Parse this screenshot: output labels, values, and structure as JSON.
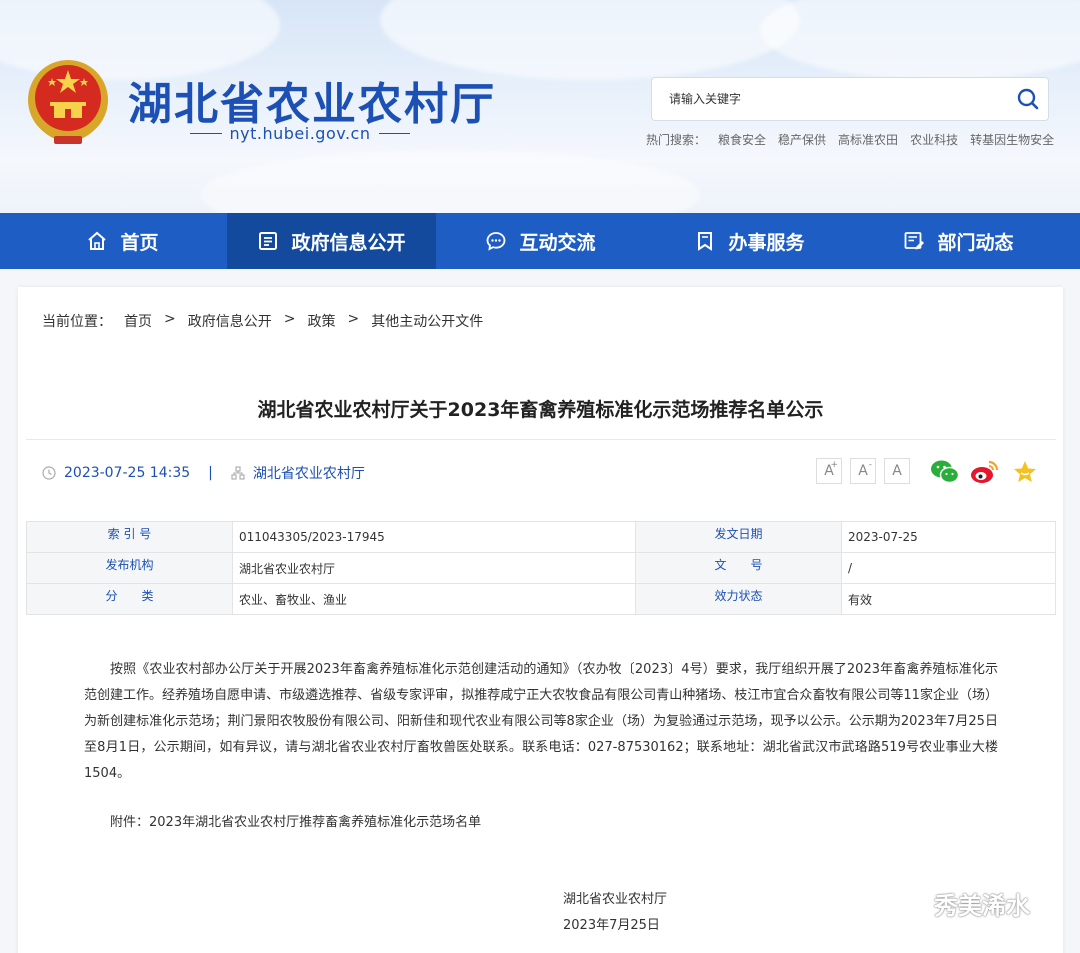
{
  "header": {
    "site_title": "湖北省农业农村厅",
    "site_url": "nyt.hubei.gov.cn",
    "search": {
      "placeholder": "请输入关键字"
    },
    "hot_search": {
      "label": "热门搜索：",
      "items": [
        "粮食安全",
        "稳产保供",
        "高标准农田",
        "农业科技",
        "转基因生物安全"
      ]
    }
  },
  "nav": {
    "items": [
      {
        "label": "首页",
        "icon": "home-icon"
      },
      {
        "label": "政府信息公开",
        "icon": "document-list-icon"
      },
      {
        "label": "互动交流",
        "icon": "chat-icon"
      },
      {
        "label": "办事服务",
        "icon": "bookmark-icon"
      },
      {
        "label": "部门动态",
        "icon": "news-icon"
      }
    ],
    "active_index": 1
  },
  "breadcrumb": {
    "label": "当前位置：",
    "items": [
      "首页",
      "政府信息公开",
      "政策",
      "其他主动公开文件"
    ],
    "separator": ">"
  },
  "article": {
    "title": "湖北省农业农村厅关于2023年畜禽养殖标准化示范场推荐名单公示",
    "datetime": "2023-07-25 14:35",
    "meta_separator": "|",
    "source": "湖北省农业农村厅",
    "font_buttons": [
      "A",
      "A",
      "A"
    ],
    "font_button_sup": [
      "+",
      "-"
    ],
    "info": {
      "rows": [
        {
          "k1": "索 引 号",
          "v1": "011043305/2023-17945",
          "k2": "发文日期",
          "v2": "2023-07-25"
        },
        {
          "k1": "发布机构",
          "v1": "湖北省农业农村厅",
          "k2": "文　　号",
          "v2": "/"
        },
        {
          "k1": "分　　类",
          "v1": "农业、畜牧业、渔业",
          "k2": "效力状态",
          "v2": "有效"
        }
      ]
    },
    "body": "按照《农业农村部办公厅关于开展2023年畜禽养殖标准化示范创建活动的通知》（农办牧〔2023〕4号）要求，我厅组织开展了2023年畜禽养殖标准化示范创建工作。经养殖场自愿申请、市级遴选推荐、省级专家评审，拟推荐咸宁正大农牧食品有限公司青山种猪场、枝江市宜合众畜牧有限公司等11家企业（场）为新创建标准化示范场；荆门景阳农牧股份有限公司、阳新佳和现代农业有限公司等8家企业（场）为复验通过示范场，现予以公示。公示期为2023年7月25日至8月1日，公示期间，如有异议，请与湖北省农业农村厅畜牧兽医处联系。联系电话：027-87530162；联系地址：湖北省武汉市武珞路519号农业事业大楼1504。",
    "attachment": "附件：2023年湖北省农业农村厅推荐畜禽养殖标准化示范场名单",
    "signature": {
      "org": "湖北省农业农村厅",
      "date": "2023年7月25日"
    }
  },
  "watermark": "秀美浠水",
  "colors": {
    "brand_blue": "#1c50b4",
    "nav_blue": "#1e5ec4",
    "nav_active": "#134a9e",
    "wechat_green": "#2aae3a",
    "weibo_red": "#e6162d",
    "star_yellow": "#f4c21f"
  }
}
